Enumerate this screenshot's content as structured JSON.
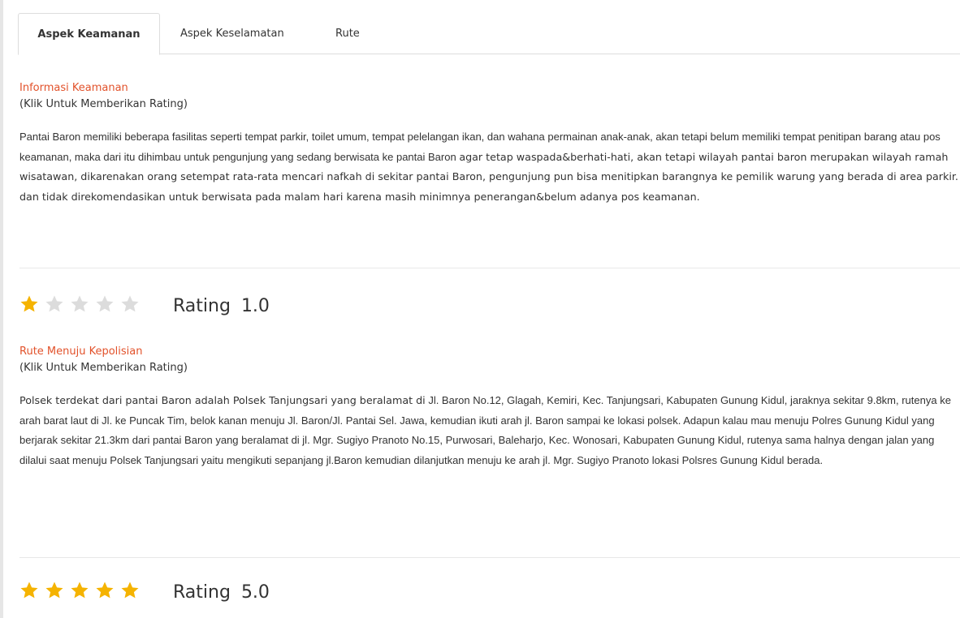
{
  "tabs": [
    {
      "label": "Aspek Keamanan",
      "active": true
    },
    {
      "label": "Aspek Keselamatan",
      "active": false
    },
    {
      "label": "Rute",
      "active": false
    }
  ],
  "sections": [
    {
      "title": "Informasi Keamanan",
      "hint": "(Klik Untuk Memberikan Rating)",
      "paragraph_a": "Pantai Baron memiliki beberapa fasilitas seperti tempat parkir, toilet umum, tempat pelelangan ikan, dan wahana permainan anak-anak, akan tetapi belum memiliki tempat penitipan barang atau pos keamanan, maka dari itu dihimbau untuk pengunjung yang sedang berwisata ke pantai Baron",
      "paragraph_b": "agar tetap waspada&berhati-hati, akan tetapi wilayah pantai baron merupakan wilayah ramah wisatawan, dikarenakan orang setempat rata-rata mencari nafkah di sekitar pantai Baron, pengunjung pun bisa menitipkan barangnya ke pemilik warung yang berada di area parkir. dan tidak direkomendasikan untuk berwisata pada malam hari karena masih minimnya penerangan&belum adanya pos keamanan.",
      "rating_word": "Rating",
      "rating_value": "1.0",
      "stars_filled": 1,
      "stars_total": 5
    },
    {
      "title": "Rute Menuju Kepolisian",
      "hint": "(Klik Untuk Memberikan Rating)",
      "paragraph_a": "Polsek terdekat dari pantai Baron adalah Polsek Tanjungsari yang beralamat di",
      "paragraph_b": "Jl. Baron No.12, Glagah, Kemiri, Kec. Tanjungsari, Kabupaten Gunung Kidul, jaraknya sekitar 9.8km, rutenya ke arah barat laut di Jl. ke Puncak Tim, belok kanan menuju Jl. Baron/Jl. Pantai Sel. Jawa, kemudian ikuti arah jl. Baron sampai ke lokasi polsek. Adapun kalau mau menuju Polres Gunung Kidul yang berjarak sekitar 21.3km dari pantai Baron yang beralamat di jl. Mgr. Sugiyo Pranoto No.15, Purwosari, Baleharjo, Kec. Wonosari, Kabupaten Gunung Kidul, rutenya sama halnya dengan jalan yang dilalui saat menuju Polsek Tanjungsari yaitu mengikuti sepanjang jl.Baron kemudian dilanjutkan menuju ke arah jl. Mgr. Sugiyo Pranoto lokasi Polsres Gunung Kidul berada.",
      "rating_word": "Rating",
      "rating_value": "5.0",
      "stars_filled": 5,
      "stars_total": 5
    }
  ],
  "colors": {
    "title": "#e2522b",
    "star_filled": "#f5b301",
    "star_empty": "#dcdcdc",
    "border": "#dddddd"
  },
  "icons": {
    "star": "star-icon"
  }
}
